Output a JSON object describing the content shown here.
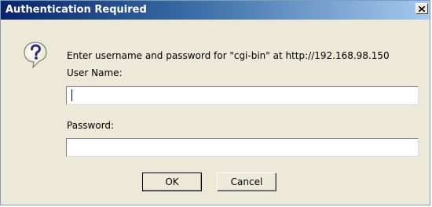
{
  "dialog": {
    "title": "Authentication Required",
    "close_glyph": "x",
    "icon": "question-icon",
    "prompt": "Enter username and password for \"cgi-bin\" at http://192.168.98.150",
    "username_label": "User Name:",
    "username_value": "",
    "password_label": "Password:",
    "password_value": "",
    "ok_label": "OK",
    "cancel_label": "Cancel"
  },
  "colors": {
    "titlebar_start": "#0a246a",
    "titlebar_end": "#a6caf0",
    "window_bg": "#ece9d8"
  }
}
